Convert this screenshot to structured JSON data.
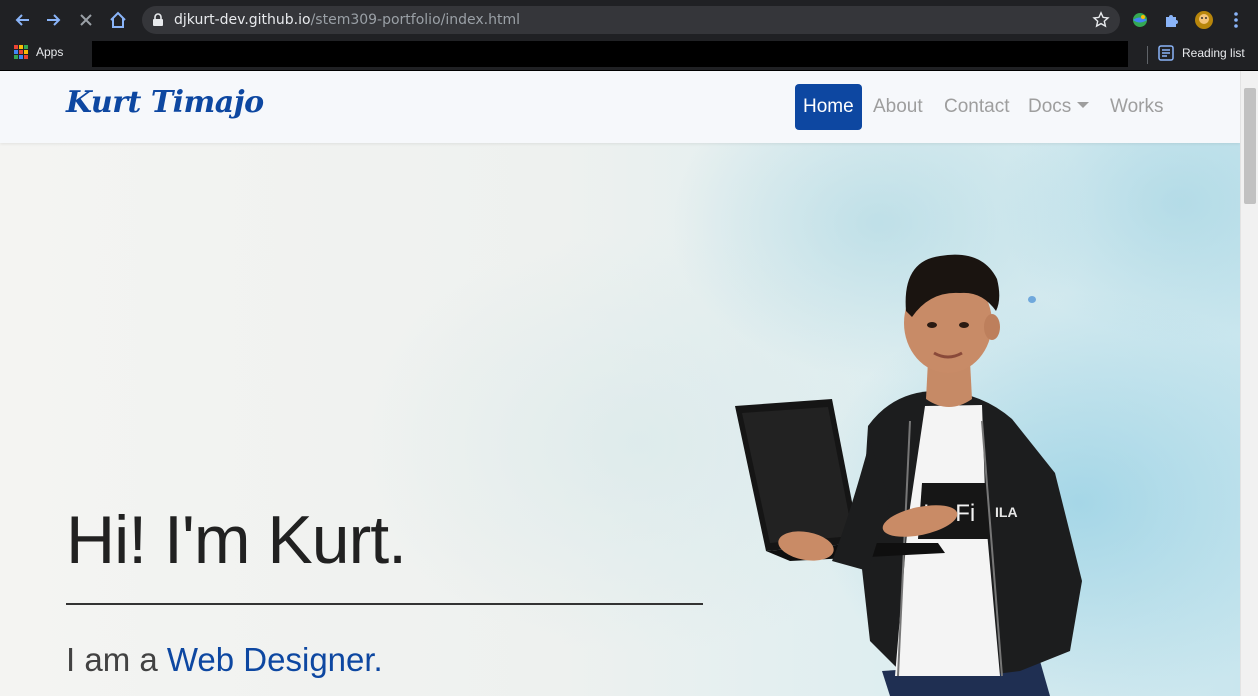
{
  "browser": {
    "url_host": "djkurt-dev.github.io",
    "url_path": "/stem309-portfolio/index.html",
    "bookmarks": {
      "apps_label": "Apps",
      "reading_list_label": "Reading list"
    }
  },
  "site": {
    "brand": "Kurt Timajo",
    "nav": {
      "home": "Home",
      "about": "About",
      "contact": "Contact",
      "docs": "Docs",
      "works": "Works"
    },
    "hero": {
      "title": "Hi! I'm Kurt.",
      "sub_prefix": "I am a",
      "role": "Web Designer."
    },
    "shirt_text": "'m Fi",
    "logo_text": "ILA"
  },
  "colors": {
    "accent": "#0d47a1",
    "chrome_bg": "#202124",
    "omnibox_bg": "#35363a"
  }
}
